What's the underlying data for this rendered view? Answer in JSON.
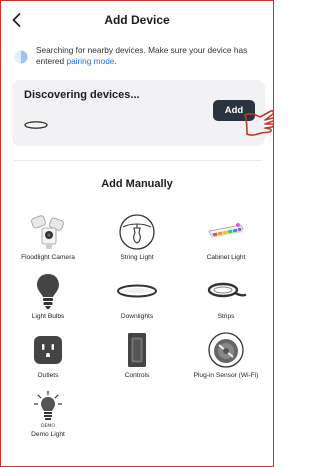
{
  "header": {
    "title": "Add Device",
    "back_icon": "chevron-left-icon"
  },
  "search": {
    "message": "Searching for nearby devices. Make sure your device has entered",
    "link": "pairing mode",
    "suffix": "."
  },
  "discovering": {
    "title": "Discovering devices...",
    "add_label": "Add"
  },
  "manual": {
    "title": "Add Manually",
    "devices": [
      {
        "label": "Floodlight Camera",
        "icon": "floodlight-camera-icon"
      },
      {
        "label": "String Light",
        "icon": "string-light-icon"
      },
      {
        "label": "Cabinet Light",
        "icon": "cabinet-light-icon"
      },
      {
        "label": "Light Bulbs",
        "icon": "light-bulb-icon"
      },
      {
        "label": "Downlights",
        "icon": "downlight-icon"
      },
      {
        "label": "Strips",
        "icon": "light-strip-icon"
      },
      {
        "label": "Outlets",
        "icon": "outlet-icon"
      },
      {
        "label": "Controls",
        "icon": "wall-switch-icon"
      },
      {
        "label": "Plug-in Sensor (Wi-Fi)",
        "icon": "plug-in-sensor-icon"
      },
      {
        "label": "Demo Light",
        "icon": "demo-light-icon"
      }
    ]
  },
  "colors": {
    "accent_link": "#1a73e8",
    "add_button": "#2b3240",
    "card_bg": "#f2f2f4",
    "frame": "#c0392b"
  }
}
